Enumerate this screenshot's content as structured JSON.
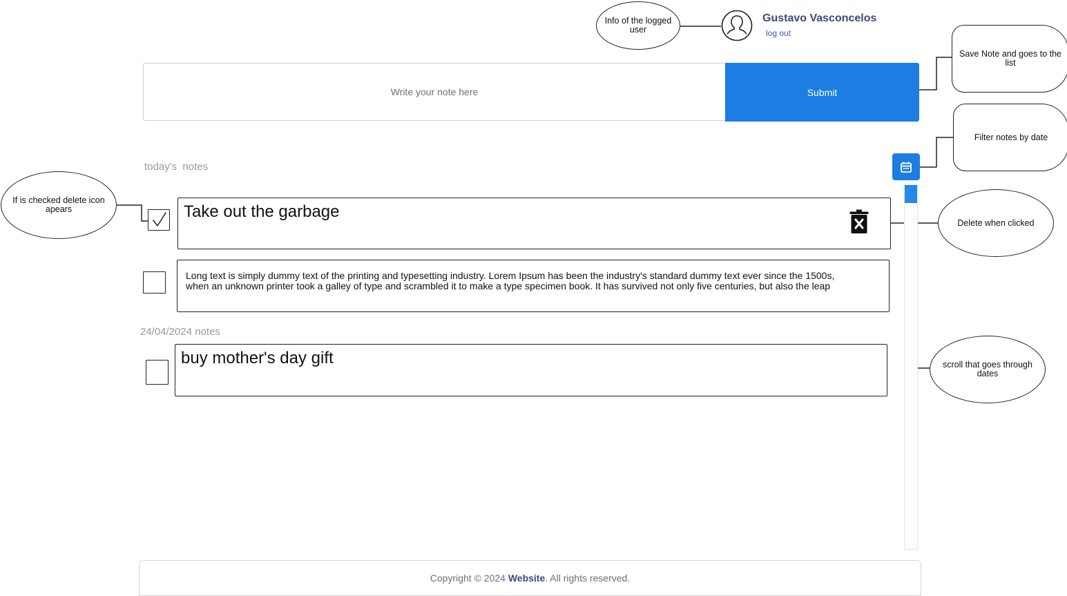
{
  "user": {
    "name": "Gustavo Vasconcelos",
    "logout_label": "log out"
  },
  "note_form": {
    "placeholder": "Write your note here",
    "submit_label": "Submit"
  },
  "sections": [
    {
      "title": "today's  notes",
      "notes": [
        {
          "text": "Take out the garbage",
          "checked": true
        },
        {
          "text": "Long text is simply dummy text of the printing and typesetting industry. Lorem Ipsum has been the industry's standard dummy text ever since the 1500s, when an unknown printer took a galley of type and scrambled it to make a type specimen book. It has survived not only five centuries, but also the leap",
          "checked": false
        }
      ]
    },
    {
      "title": "24/04/2024 notes",
      "notes": [
        {
          "text": "buy mother's day gift",
          "checked": false
        }
      ]
    }
  ],
  "callouts": {
    "logged_user": "Info of the logged user",
    "save_note": "Save Note and goes to the list",
    "filter_date": "Filter notes by date",
    "checked_delete": "If is checked delete icon apears",
    "delete_click": "Delete when clicked",
    "scroll_dates": "scroll that goes through dates"
  },
  "footer": {
    "prefix": "Copyright © 2024 ",
    "brand": "Website",
    "suffix": ". All rights reserved."
  },
  "colors": {
    "primary": "#1d7de3",
    "user_name": "#3b4a7a",
    "muted": "#9a9a9a"
  },
  "icons": [
    "user-avatar-icon",
    "calendar-icon",
    "trash-delete-icon",
    "checkmark-icon"
  ]
}
